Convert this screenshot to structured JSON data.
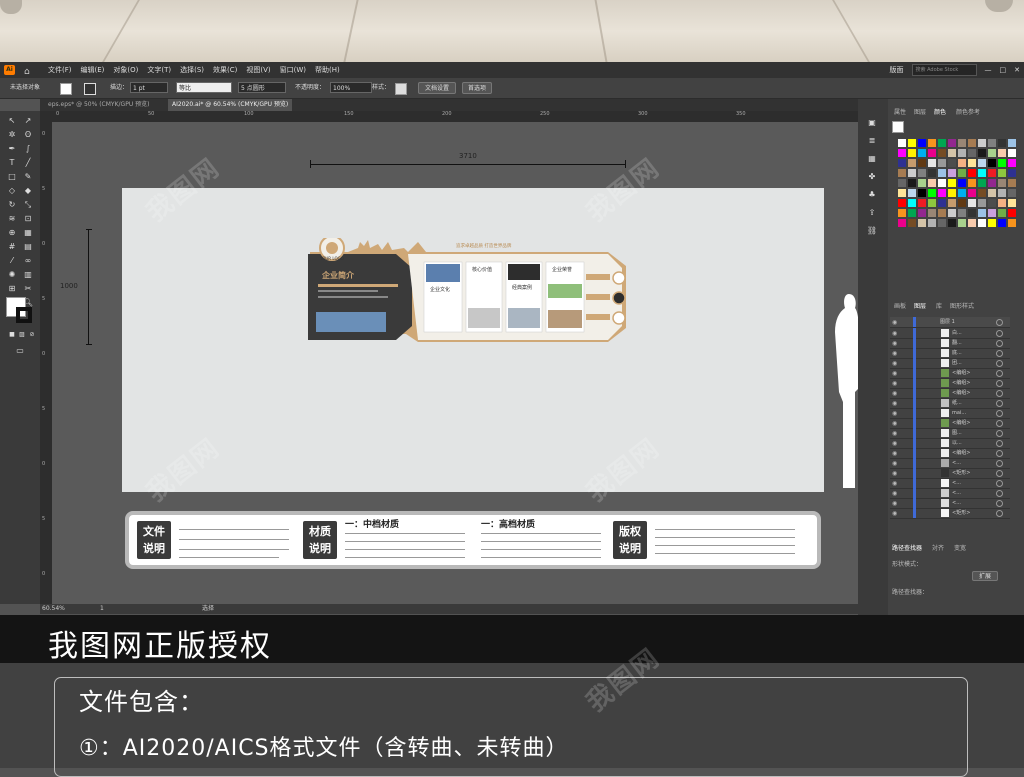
{
  "menubar": {
    "menus": [
      "文件(F)",
      "编辑(E)",
      "对象(O)",
      "文字(T)",
      "选择(S)",
      "效果(C)",
      "视图(V)",
      "窗口(W)",
      "帮助(H)"
    ],
    "workspace": "版面",
    "search_placeholder": "搜索 Adobe Stock"
  },
  "controlbar": {
    "selection_label": "未选择对象",
    "stroke_label": "描边：",
    "stroke_value": "1 pt",
    "stroke_profile": "等比",
    "brush_value": "5 点圆形",
    "opacity_label": "不透明度：",
    "opacity_value": "100%",
    "style_label": "样式：",
    "doc_setup_button": "文档设置",
    "prefs_button": "首选项"
  },
  "tabs": [
    {
      "label": "eps.eps* @ 50% (CMYK/GPU 预览)",
      "active": false
    },
    {
      "label": "AI2020.ai* @ 60.54% (CMYK/GPU 预览)",
      "active": true
    }
  ],
  "ruler": {
    "h_ticks": [
      "0",
      "50",
      "100",
      "150",
      "200",
      "250",
      "300",
      "350"
    ],
    "v_ticks": [
      "0",
      "5",
      "0",
      "5",
      "0",
      "5",
      "0",
      "5",
      "0"
    ]
  },
  "canvas": {
    "width_label": "3710",
    "height_label": "1000",
    "wall": {
      "logo_text": "YOUR LOGO",
      "heading": "企业简介",
      "slogan": "追求卓越品质  打造世界品牌",
      "card_titles": [
        "企业文化",
        "核心价值",
        "经典案例",
        "企业荣誉"
      ]
    }
  },
  "strip": {
    "badge1": [
      "文件",
      "说明"
    ],
    "section1": "一：中档材质",
    "section2": "一：高档材质",
    "badge2": [
      "材质",
      "说明"
    ],
    "badge3": [
      "版权",
      "说明"
    ]
  },
  "statusbar": {
    "zoom": "60.54%",
    "page": "1",
    "tool": "选择"
  },
  "rightpanel": {
    "top_tabs": [
      "属性",
      "图层",
      "颜色",
      "颜色参考"
    ],
    "mid_tabs": [
      "画板",
      "图层",
      "库",
      "图形样式"
    ],
    "layer_top": "图层 1",
    "layers": [
      "白...",
      "翻...",
      "底...",
      "团...",
      "<编组>",
      "<编组>",
      "<编组>",
      "纸...",
      "mai...",
      "<编组>",
      "图...",
      "以...",
      "<编组>",
      "<...",
      "<矩形>",
      "<...",
      "<...",
      "<...",
      "<矩形>"
    ],
    "bottom_tabs": [
      "路径查找器",
      "対齐",
      "变宽"
    ],
    "shape_mode_label": "形状模式：",
    "pathfinder_label": "路径查找器：",
    "expand_button": "扩展"
  },
  "banner": {
    "title": "我图网正版授权",
    "line1": "文件包含：",
    "line2": "①：AI2020/AICS格式文件（含转曲、未转曲）"
  },
  "watermark": "我图网"
}
